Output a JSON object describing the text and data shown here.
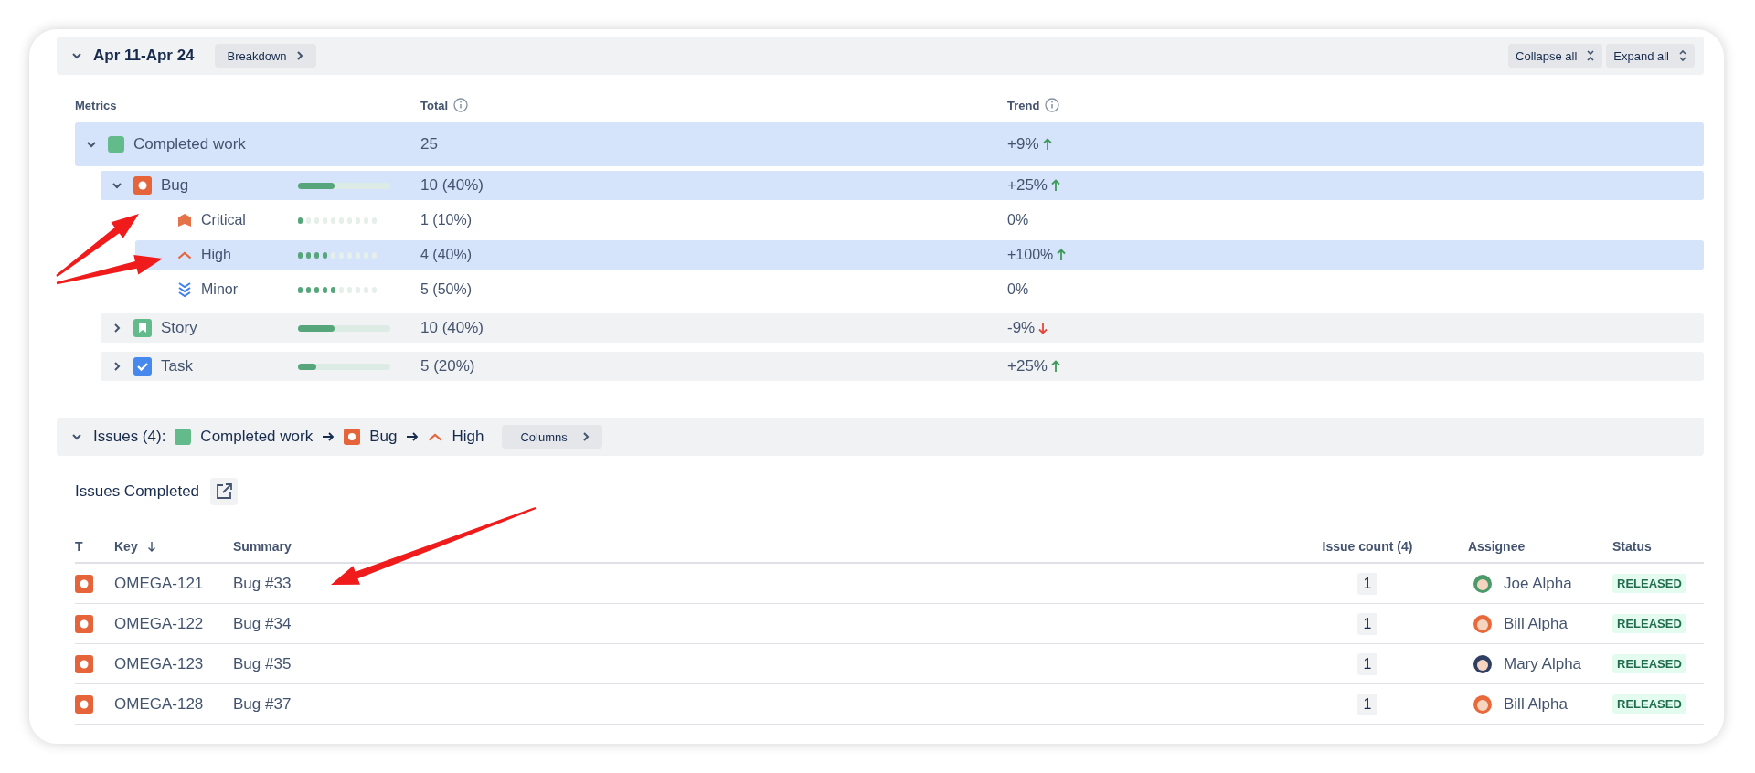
{
  "period": {
    "title": "Apr 11-Apr 24",
    "expanded": true,
    "breakdown_label": "Breakdown",
    "collapse_label": "Collapse all",
    "expand_label": "Expand all"
  },
  "metrics": {
    "columns": [
      {
        "label": "Metrics",
        "info": false
      },
      {
        "label": "Total",
        "info": true
      },
      {
        "label": "Trend",
        "info": true
      }
    ],
    "rows": [
      {
        "kind": "completed",
        "label": "Completed work",
        "total": "25",
        "trend": "+9%",
        "trend_up": true,
        "trend_down": false,
        "expanded": true,
        "selected": true,
        "children": [
          {
            "kind": "bug",
            "label": "Bug",
            "level": 0.4,
            "total": "10 (40%)",
            "trend": "+25%",
            "trend_up": true,
            "trend_down": false,
            "expanded": true,
            "selected": true,
            "children": [
              {
                "kind": "critical",
                "label": "Critical",
                "level": 0.1,
                "total": "1 (10%)",
                "trend": "0%",
                "trend_up": false,
                "trend_down": false,
                "selected": false
              },
              {
                "kind": "high",
                "label": "High",
                "level": 0.4,
                "total": "4 (40%)",
                "trend": "+100%",
                "trend_up": true,
                "trend_down": false,
                "selected": true
              },
              {
                "kind": "minor",
                "label": "Minor",
                "level": 0.5,
                "total": "5 (50%)",
                "trend": "0%",
                "trend_up": false,
                "trend_down": false,
                "selected": false
              }
            ]
          },
          {
            "kind": "story",
            "label": "Story",
            "level": 0.4,
            "total": "10 (40%)",
            "trend": "-9%",
            "trend_up": false,
            "trend_down": true,
            "expanded": false,
            "selected": false
          },
          {
            "kind": "task",
            "label": "Task",
            "level": 0.2,
            "total": "5 (20%)",
            "trend": "+25%",
            "trend_up": true,
            "trend_down": false,
            "expanded": false,
            "selected": false
          }
        ]
      }
    ]
  },
  "issues": {
    "expanded": true,
    "count_label": "Issues (4):",
    "path": [
      {
        "kind": "completed",
        "label": "Completed work"
      },
      {
        "kind": "bug",
        "label": "Bug"
      },
      {
        "kind": "high",
        "label": "High"
      }
    ],
    "columns_label": "Columns",
    "table": {
      "title": "Issues Completed",
      "columns": [
        {
          "label": "T",
          "sorted": false
        },
        {
          "label": "Key",
          "sorted": true
        },
        {
          "label": "Summary",
          "sorted": false
        },
        {
          "label": "Issue count (4)",
          "sorted": false
        },
        {
          "label": "Assignee",
          "sorted": false
        },
        {
          "label": "Status",
          "sorted": false
        }
      ],
      "rows": [
        {
          "kind": "bug",
          "key": "OMEGA-121",
          "summary": "Bug #33",
          "count": "1",
          "assignee": "Joe Alpha",
          "color": "#4a9a6a",
          "status": "RELEASED"
        },
        {
          "kind": "bug",
          "key": "OMEGA-122",
          "summary": "Bug #34",
          "count": "1",
          "assignee": "Bill Alpha",
          "color": "#e86a3a",
          "status": "RELEASED"
        },
        {
          "kind": "bug",
          "key": "OMEGA-123",
          "summary": "Bug #35",
          "count": "1",
          "assignee": "Mary Alpha",
          "color": "#2f3e63",
          "status": "RELEASED"
        },
        {
          "kind": "bug",
          "key": "OMEGA-128",
          "summary": "Bug #37",
          "count": "1",
          "assignee": "Bill Alpha",
          "color": "#e86a3a",
          "status": "RELEASED"
        }
      ]
    }
  }
}
